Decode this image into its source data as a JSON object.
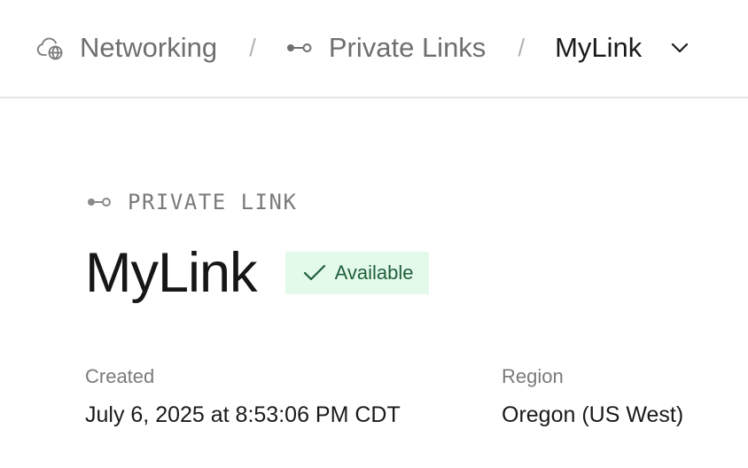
{
  "breadcrumb": {
    "items": [
      {
        "label": "Networking",
        "icon": "cloud-globe-icon"
      },
      {
        "label": "Private Links",
        "icon": "private-link-icon"
      },
      {
        "label": "MyLink",
        "icon": "chevron-down-icon"
      }
    ],
    "separator": "/"
  },
  "header": {
    "eyebrow": "PRIVATE LINK",
    "eyebrow_icon": "private-link-icon",
    "title": "MyLink",
    "status": {
      "label": "Available",
      "icon": "check-icon",
      "background": "#e3f9ea",
      "color": "#1f5f3a"
    }
  },
  "details": {
    "created_label": "Created",
    "created_value": "July 6, 2025 at 8:53:06 PM CDT",
    "region_label": "Region",
    "region_value": "Oregon (US West)"
  }
}
